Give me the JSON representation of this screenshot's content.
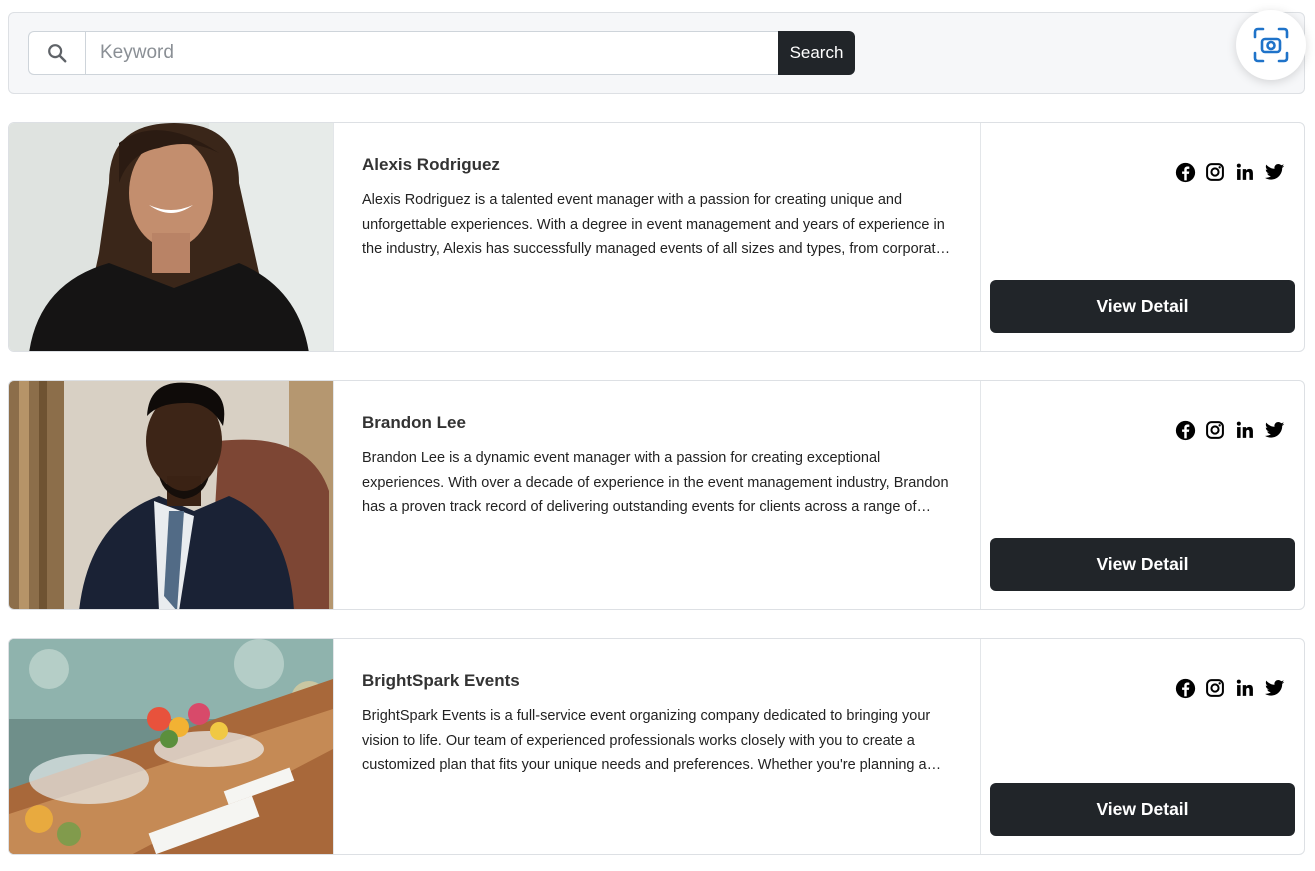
{
  "search": {
    "placeholder": "Keyword",
    "button_label": "Search",
    "icon": "search-icon"
  },
  "scan_button": {
    "icon": "camera-scan-icon",
    "color": "#1f73c9"
  },
  "cards": [
    {
      "name": "Alexis Rodriguez",
      "description": "Alexis Rodriguez is a talented event manager with a passion for creating unique and unforgettable experiences. With a degree in event management and years of experience in the industry, Alexis has successfully managed events of all sizes and types, from corporate conferences to weddings.",
      "photo": "portrait of smiling woman with long dark hair",
      "social_icons": [
        "facebook-icon",
        "instagram-icon",
        "linkedin-icon",
        "twitter-icon"
      ],
      "button_label": "View Detail"
    },
    {
      "name": "Brandon Lee",
      "description": "Brandon Lee is a dynamic event manager with a passion for creating exceptional experiences. With over a decade of experience in the event management industry, Brandon has a proven track record of delivering outstanding events for clients across a range of industries.",
      "photo": "portrait of man in suit seated in leather chair",
      "social_icons": [
        "facebook-icon",
        "instagram-icon",
        "linkedin-icon",
        "twitter-icon"
      ],
      "button_label": "View Detail"
    },
    {
      "name": "BrightSpark Events",
      "description": "BrightSpark Events is a full-service event organizing company dedicated to bringing your vision to life. Our team of experienced professionals works closely with you to create a customized plan that fits your unique needs and preferences. Whether you're planning a wedding or a corporate event.",
      "photo": "banquet table with glasses and flower arrangements",
      "social_icons": [
        "facebook-icon",
        "instagram-icon",
        "linkedin-icon",
        "twitter-icon"
      ],
      "button_label": "View Detail"
    }
  ],
  "colors": {
    "dark_button": "#212529",
    "panel_background": "#f6f7f9",
    "border": "#dde0e4"
  }
}
